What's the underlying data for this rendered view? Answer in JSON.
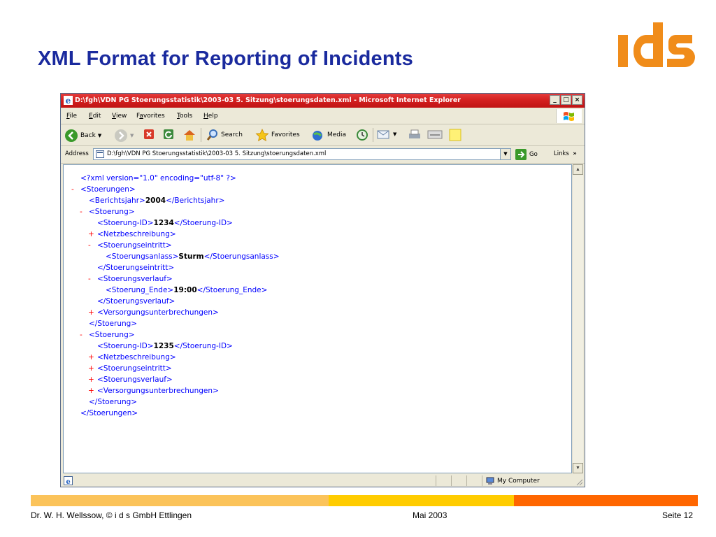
{
  "slide": {
    "title": "XML Format for Reporting of Incidents",
    "logo_text": "ids"
  },
  "window": {
    "title": "D:\\fgh\\VDN PG Stoerungsstatistik\\2003-03 5. Sitzung\\stoerungsdaten.xml - Microsoft Internet Explorer",
    "buttons": [
      "_",
      "□",
      "×"
    ]
  },
  "menu": [
    {
      "u": "F",
      "rest": "ile"
    },
    {
      "u": "E",
      "rest": "dit"
    },
    {
      "u": "V",
      "rest": "iew"
    },
    {
      "pre": "F",
      "u": "a",
      "rest": "vorites"
    },
    {
      "u": "T",
      "rest": "ools"
    },
    {
      "u": "H",
      "rest": "elp"
    }
  ],
  "toolbar": {
    "back": "Back",
    "search": "Search",
    "favorites": "Favorites",
    "media": "Media"
  },
  "address": {
    "label": "Address",
    "value": "D:\\fgh\\VDN PG Stoerungsstatistik\\2003-03 5. Sitzung\\stoerungsdaten.xml",
    "go": "Go",
    "links": "Links",
    "links_more": "»"
  },
  "xml_lines": [
    {
      "marker": "",
      "indent": 0,
      "text": "<?xml version=\"1.0\" encoding=\"utf-8\" ?>",
      "value": "",
      "close": ""
    },
    {
      "marker": "-",
      "indent": 0,
      "text": "<Stoerungen>",
      "value": "",
      "close": ""
    },
    {
      "marker": "",
      "indent": 1,
      "text": "<Berichtsjahr>",
      "value": "2004",
      "close": "</Berichtsjahr>"
    },
    {
      "marker": "-",
      "indent": 1,
      "text": "<Stoerung>",
      "value": "",
      "close": ""
    },
    {
      "marker": "",
      "indent": 2,
      "text": "<Stoerung-ID>",
      "value": "1234",
      "close": "</Stoerung-ID>"
    },
    {
      "marker": "+",
      "indent": 2,
      "text": "<Netzbeschreibung>",
      "value": "",
      "close": ""
    },
    {
      "marker": "-",
      "indent": 2,
      "text": "<Stoerungseintritt>",
      "value": "",
      "close": ""
    },
    {
      "marker": "",
      "indent": 3,
      "text": "<Stoerungsanlass>",
      "value": "Sturm",
      "close": "</Stoerungsanlass>"
    },
    {
      "marker": "",
      "indent": 2,
      "text": "</Stoerungseintritt>",
      "value": "",
      "close": ""
    },
    {
      "marker": "-",
      "indent": 2,
      "text": "<Stoerungsverlauf>",
      "value": "",
      "close": ""
    },
    {
      "marker": "",
      "indent": 3,
      "text": "<Stoerung_Ende>",
      "value": "19:00",
      "close": "</Stoerung_Ende>"
    },
    {
      "marker": "",
      "indent": 2,
      "text": "</Stoerungsverlauf>",
      "value": "",
      "close": ""
    },
    {
      "marker": "+",
      "indent": 2,
      "text": "<Versorgungsunterbrechungen>",
      "value": "",
      "close": ""
    },
    {
      "marker": "",
      "indent": 1,
      "text": "</Stoerung>",
      "value": "",
      "close": ""
    },
    {
      "marker": "-",
      "indent": 1,
      "text": "<Stoerung>",
      "value": "",
      "close": ""
    },
    {
      "marker": "",
      "indent": 2,
      "text": "<Stoerung-ID>",
      "value": "1235",
      "close": "</Stoerung-ID>"
    },
    {
      "marker": "+",
      "indent": 2,
      "text": "<Netzbeschreibung>",
      "value": "",
      "close": ""
    },
    {
      "marker": "+",
      "indent": 2,
      "text": "<Stoerungseintritt>",
      "value": "",
      "close": ""
    },
    {
      "marker": "+",
      "indent": 2,
      "text": "<Stoerungsverlauf>",
      "value": "",
      "close": ""
    },
    {
      "marker": "+",
      "indent": 2,
      "text": "<Versorgungsunterbrechungen>",
      "value": "",
      "close": ""
    },
    {
      "marker": "",
      "indent": 1,
      "text": "</Stoerung>",
      "value": "",
      "close": ""
    },
    {
      "marker": "",
      "indent": 0,
      "text": "</Stoerungen>",
      "value": "",
      "close": ""
    }
  ],
  "status": {
    "zone": "My Computer"
  },
  "footer": {
    "left": "Dr. W. H. Wellssow, © i d s GmbH Ettlingen",
    "center": "Mai 2003",
    "right": "Seite 12"
  },
  "colors": {
    "title": "#1a2a9e",
    "accent_orange": "#ff6600",
    "accent_light_orange": "#fbc35a",
    "accent_yellow": "#ffcc00",
    "xml_tag": "#0000ff",
    "xml_marker": "#ff0000"
  }
}
